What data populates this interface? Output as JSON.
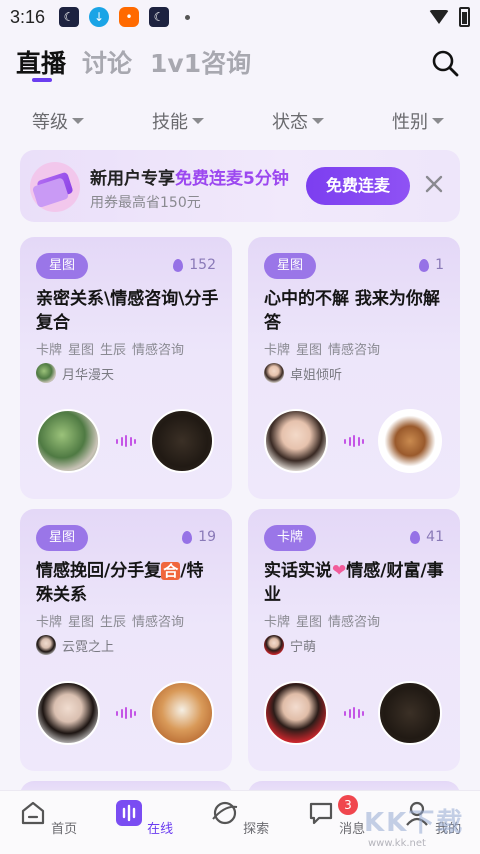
{
  "status_bar": {
    "time": "3:16",
    "icons": [
      "moon-app-icon",
      "download-icon",
      "shop-app-icon",
      "moon-app-icon",
      "dot-icon",
      "wifi-icon",
      "battery-icon"
    ]
  },
  "top_tabs": [
    {
      "label": "直播",
      "active": true
    },
    {
      "label": "讨论",
      "active": false
    },
    {
      "label": "1v1咨询",
      "active": false
    }
  ],
  "filters": [
    "等级",
    "技能",
    "状态",
    "性别"
  ],
  "banner": {
    "title_prefix": "新用户专享",
    "title_highlight": "免费连麦5分钟",
    "subtitle": "用券最高省150元",
    "button": "免费连麦"
  },
  "cards": [
    {
      "tag": "星图",
      "heat": "152",
      "title": "亲密关系\\情感咨询\\分手复合",
      "tags": [
        "卡牌",
        "星图",
        "生辰",
        "情感咨询"
      ],
      "host": "月华漫天"
    },
    {
      "tag": "星图",
      "heat": "1",
      "title": "心中的不解  我来为你解答",
      "tags": [
        "卡牌",
        "星图",
        "情感咨询"
      ],
      "host": "卓姐倾听"
    },
    {
      "tag": "星图",
      "heat": "19",
      "title_a": "情感挽回/分手复",
      "title_emoji": "合",
      "title_b": "/特殊关系",
      "tags": [
        "卡牌",
        "星图",
        "生辰",
        "情感咨询"
      ],
      "host": "云霓之上"
    },
    {
      "tag": "卡牌",
      "heat": "41",
      "title_a": "实话实说",
      "title_b": "情感/财富/事业",
      "tags": [
        "卡牌",
        "星图",
        "情感咨询"
      ],
      "host": "宁萌"
    }
  ],
  "bottom_nav": [
    {
      "label": "首页",
      "active": false
    },
    {
      "label": "在线",
      "active": true
    },
    {
      "label": "探索",
      "active": false
    },
    {
      "label": "消息",
      "active": false,
      "badge": "3"
    },
    {
      "label": "我的",
      "active": false
    }
  ],
  "watermark": {
    "text": "KK下载",
    "url": "www.kk.net"
  },
  "colors": {
    "accent": "#6b3df0",
    "highlight": "#9c48f0",
    "tag": "#9a76e8",
    "badge": "#f0464e"
  }
}
